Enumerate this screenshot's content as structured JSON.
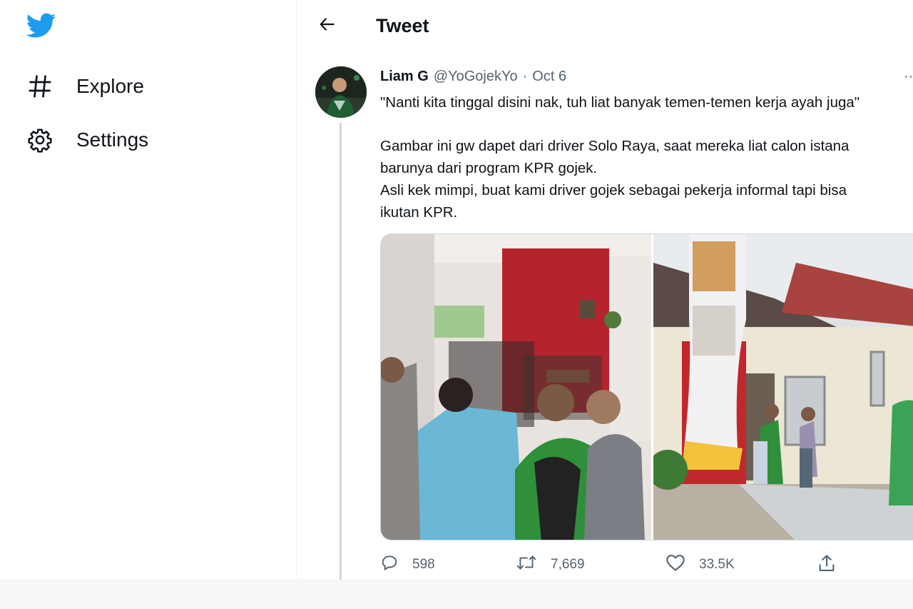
{
  "sidebar": {
    "logo_icon": "twitter-bird-icon",
    "brand_color": "#1d9bf0",
    "items": [
      {
        "label": "Explore",
        "icon": "hashtag-icon"
      },
      {
        "label": "Settings",
        "icon": "gear-icon"
      }
    ]
  },
  "header": {
    "back_icon": "back-arrow-icon",
    "title": "Tweet"
  },
  "tweet": {
    "author_name": "Liam G",
    "handle": "@YoGojekYo",
    "separator": "·",
    "date": "Oct 6",
    "more": "··",
    "text_lines": [
      "\"Nanti kita tinggal disini nak, tuh liat banyak temen-temen kerja ayah juga\"",
      "Gambar ini gw dapet dari driver Solo Raya, saat mereka liat calon istana",
      "barunya dari program KPR gojek.",
      "Asli kek mimpi, buat kami driver gojek sebagai pekerja informal tapi bisa",
      "ikutan KPR."
    ],
    "photos": [
      {
        "description_icon": "photo-interior-crowd"
      },
      {
        "description_icon": "photo-house-exterior"
      }
    ],
    "stats": {
      "replies": "598",
      "retweets": "7,669",
      "likes": "33.5K"
    }
  },
  "colors": {
    "text_primary": "#0f1419",
    "text_secondary": "#536471",
    "border": "#cfd9de"
  }
}
